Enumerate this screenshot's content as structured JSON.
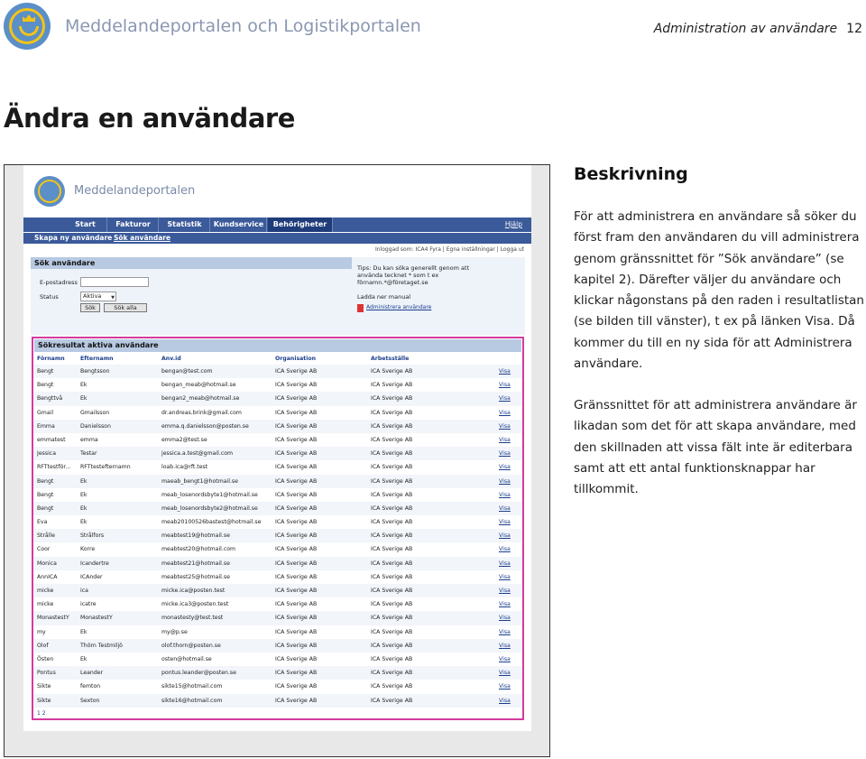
{
  "document": {
    "brand": "Meddelandeportalen och Logistikportalen",
    "section": "Administration av användare",
    "page_number": "12",
    "title": "Ändra en användare"
  },
  "description": {
    "heading": "Beskrivning",
    "p1": "För att administrera en användare så söker du först fram den användaren du vill administrera genom gränssnittet för ”Sök användare” (se kapitel 2). Därefter väljer du användare och klickar någonstans på den raden i resultatlistan (se bilden till vänster), t ex på länken Visa. Då kommer du till en ny sida för att Administrera användare.",
    "p2": "Gränssnittet för att administrera användare är likadan som det för att skapa användare, med den skillnaden att vissa fält inte är editerbara samt att ett antal funktionsknappar har tillkommit."
  },
  "app": {
    "brand": "Meddelandeportalen",
    "nav_tabs": [
      "Start",
      "Fakturor",
      "Statistik",
      "Kundservice",
      "Behörigheter"
    ],
    "help": "Hjälp",
    "subnav": [
      "Skapa ny användare",
      "Sök användare"
    ],
    "login_info": "Inloggad som: ICA4 Fyra | Egna inställningar | Logga ut",
    "search": {
      "title": "Sök användare",
      "email_label": "E-postadress",
      "status_label": "Status",
      "status_value": "Aktiva",
      "search_button": "Sök",
      "search_all_button": "Sök alla",
      "tips": "Tips: Du kan söka generellt genom att använda tecknet * som t ex förnamn.*@företaget.se",
      "manual_title": "Ladda ner manual",
      "manual_link": "Administrera användare"
    },
    "results": {
      "title": "Sökresultat aktiva användare",
      "columns": [
        "Förnamn",
        "Efternamn",
        "Anv.id",
        "Organisation",
        "Arbetsställe",
        ""
      ],
      "rows": [
        [
          "Bengt",
          "Bengtsson",
          "bengan@test.com",
          "ICA Sverige AB",
          "ICA Sverige AB",
          "Visa"
        ],
        [
          "Bengt",
          "Ek",
          "bengan_meab@hotmail.se",
          "ICA Sverige AB",
          "ICA Sverige AB",
          "Visa"
        ],
        [
          "Bengttvå",
          "Ek",
          "bengan2_meab@hotmail.se",
          "ICA Sverige AB",
          "ICA Sverige AB",
          "Visa"
        ],
        [
          "Gmail",
          "Gmailsson",
          "dr.andreas.brink@gmail.com",
          "ICA Sverige AB",
          "ICA Sverige AB",
          "Visa"
        ],
        [
          "Emma",
          "Danielsson",
          "emma.q.danielsson@posten.se",
          "ICA Sverige AB",
          "ICA Sverige AB",
          "Visa"
        ],
        [
          "emmatest",
          "emma",
          "emma2@test.se",
          "ICA Sverige AB",
          "ICA Sverige AB",
          "Visa"
        ],
        [
          "Jessica",
          "Testar",
          "jessica.a.test@gmail.com",
          "ICA Sverige AB",
          "ICA Sverige AB",
          "Visa"
        ],
        [
          "RFTtestför...",
          "RFTtestefternamn",
          "loab.ica@rft.test",
          "ICA Sverige AB",
          "ICA Sverige AB",
          "Visa"
        ],
        [
          "Bengt",
          "Ek",
          "maeab_bengt1@hotmail.se",
          "ICA Sverige AB",
          "ICA Sverige AB",
          "Visa"
        ],
        [
          "Bengt",
          "Ek",
          "meab_losenordsbyte1@hotmail.se",
          "ICA Sverige AB",
          "ICA Sverige AB",
          "Visa"
        ],
        [
          "Bengt",
          "Ek",
          "meab_losenordsbyte2@hotmail.se",
          "ICA Sverige AB",
          "ICA Sverige AB",
          "Visa"
        ],
        [
          "Eva",
          "Ek",
          "meab20100526bastest@hotmail.se",
          "ICA Sverige AB",
          "ICA Sverige AB",
          "Visa"
        ],
        [
          "Strålle",
          "Strålfors",
          "meabtest19@hotmail.se",
          "ICA Sverige AB",
          "ICA Sverige AB",
          "Visa"
        ],
        [
          "Coor",
          "Korre",
          "meabtest20@hotmail.com",
          "ICA Sverige AB",
          "ICA Sverige AB",
          "Visa"
        ],
        [
          "Monica",
          "Icandertre",
          "meabtest21@hotmail.se",
          "ICA Sverige AB",
          "ICA Sverige AB",
          "Visa"
        ],
        [
          "AnnICA",
          "ICAnder",
          "meabtest25@hotmail.se",
          "ICA Sverige AB",
          "ICA Sverige AB",
          "Visa"
        ],
        [
          "micke",
          "ica",
          "micke.ica@posten.test",
          "ICA Sverige AB",
          "ICA Sverige AB",
          "Visa"
        ],
        [
          "micke",
          "icatre",
          "micke.ica3@posten.test",
          "ICA Sverige AB",
          "ICA Sverige AB",
          "Visa"
        ],
        [
          "MonastestY",
          "MonastestY",
          "monastesty@test.test",
          "ICA Sverige AB",
          "ICA Sverige AB",
          "Visa"
        ],
        [
          "my",
          "Ek",
          "my@p.se",
          "ICA Sverige AB",
          "ICA Sverige AB",
          "Visa"
        ],
        [
          "Olof",
          "Thörn Testmiljö",
          "olof.thorn@posten.se",
          "ICA Sverige AB",
          "ICA Sverige AB",
          "Visa"
        ],
        [
          "Östen",
          "Ek",
          "osten@hotmail.se",
          "ICA Sverige AB",
          "ICA Sverige AB",
          "Visa"
        ],
        [
          "Pontus",
          "Leander",
          "pontus.leander@posten.se",
          "ICA Sverige AB",
          "ICA Sverige AB",
          "Visa"
        ],
        [
          "Sikte",
          "femton",
          "sikte15@hotmail.com",
          "ICA Sverige AB",
          "ICA Sverige AB",
          "Visa"
        ],
        [
          "Sikte",
          "Sexton",
          "sikte16@hotmail.com",
          "ICA Sverige AB",
          "ICA Sverige AB",
          "Visa"
        ]
      ],
      "pager": "1 2"
    }
  }
}
